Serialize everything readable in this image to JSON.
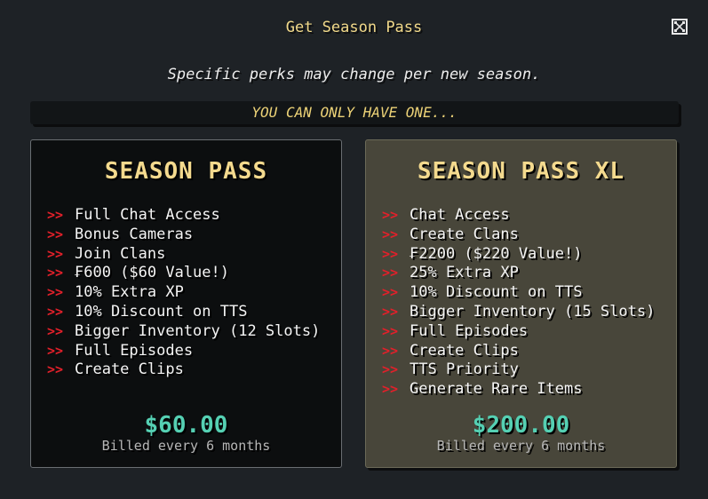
{
  "modal": {
    "title": "Get Season Pass",
    "subtitle": "Specific perks may change per new season.",
    "banner": "YOU CAN ONLY HAVE ONE..."
  },
  "bullet": ">>",
  "plans": [
    {
      "name": "SEASON PASS",
      "perks": [
        "Full Chat Access",
        "Bonus Cameras",
        "Join Clans",
        "₣600 ($60 Value!)",
        "10% Extra XP",
        "10% Discount on TTS",
        "Bigger Inventory (12 Slots)",
        "Full Episodes",
        "Create Clips"
      ],
      "price": "$60.00",
      "billing": "Billed every 6 months"
    },
    {
      "name": "SEASON PASS XL",
      "perks": [
        "Chat Access",
        "Create Clans",
        "₣2200 ($220 Value!)",
        "25% Extra XP",
        "10% Discount on TTS",
        "Bigger Inventory (15 Slots)",
        "Full Episodes",
        "Create Clips",
        "TTS Priority",
        "Generate Rare Items"
      ],
      "price": "$200.00",
      "billing": "Billed every 6 months"
    }
  ],
  "icons": {
    "close": "close-icon"
  },
  "colors": {
    "background": "#1e2226",
    "title": "#f1d98a",
    "banner_text": "#ecd277",
    "bullet": "#e2202a",
    "price": "#55d0b3",
    "card_xl_background": "#48463a",
    "card_background": "#0c0e0f"
  }
}
